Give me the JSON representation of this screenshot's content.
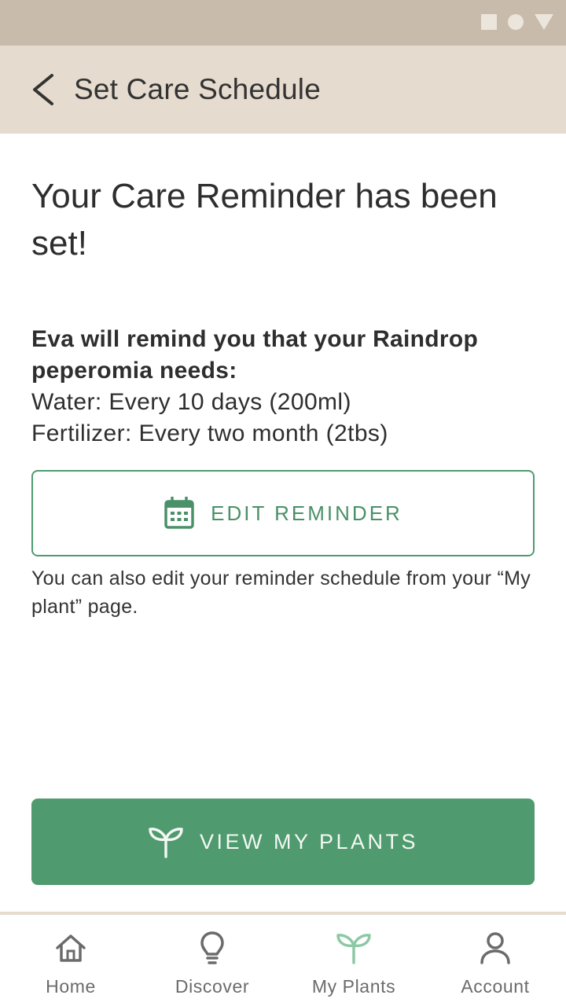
{
  "colors": {
    "status_bar": "#c9bbab",
    "app_bar": "#e6dbcf",
    "accent_green": "#4f9a6e",
    "text_dark": "#2e2e2e",
    "nav_icon_gray": "#6b6b6b",
    "nav_icon_active": "#8cc8a3"
  },
  "app_bar": {
    "back_icon": "chevron-left-icon",
    "title": "Set Care Schedule"
  },
  "main": {
    "headline": "Your Care Reminder has been set!",
    "lead": "Eva will remind you that your Raindrop peperomia needs:",
    "water": "Water: Every 10 days (200ml)",
    "fertilizer": "Fertilizer: Every two month (2tbs)",
    "edit_button": {
      "icon": "calendar-icon",
      "label": "EDIT REMINDER"
    },
    "helper_text": "You can also edit your reminder schedule from your  “My plant” page."
  },
  "primary_button": {
    "icon": "sprout-icon",
    "label": "VIEW MY PLANTS"
  },
  "bottom_nav": {
    "items": [
      {
        "label": "Home",
        "icon": "home-icon"
      },
      {
        "label": "Discover",
        "icon": "lightbulb-icon"
      },
      {
        "label": "My Plants",
        "icon": "sprout-icon",
        "active": true
      },
      {
        "label": "Account",
        "icon": "person-icon"
      }
    ]
  }
}
